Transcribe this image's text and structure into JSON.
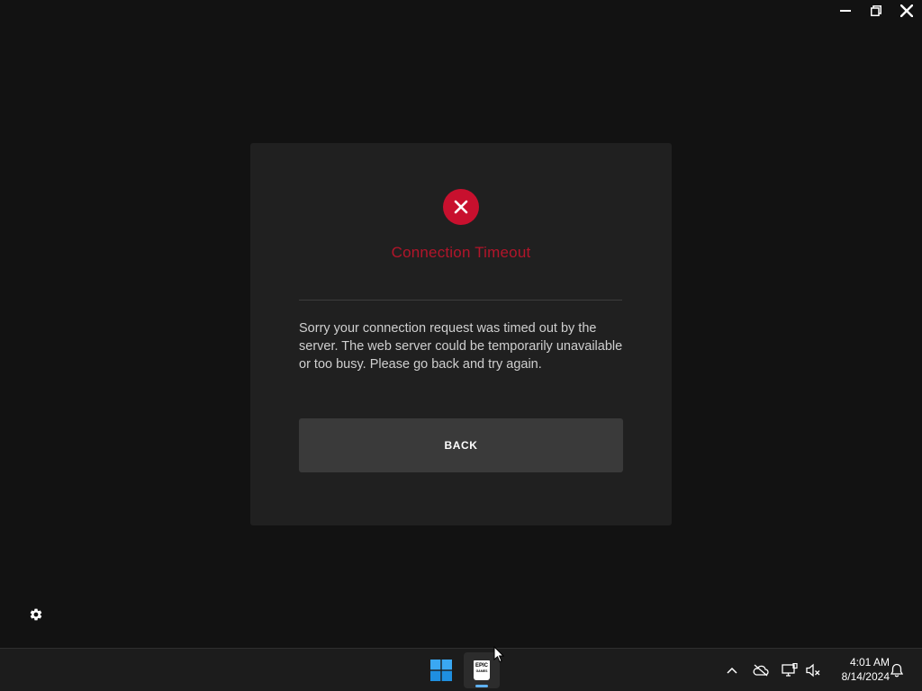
{
  "window": {
    "minimize_icon": "minimize-icon",
    "restore_icon": "restore-icon",
    "close_icon": "close-icon"
  },
  "dialog": {
    "icon": "error-circle-icon",
    "title": "Connection Timeout",
    "message": "Sorry your connection request was timed out by the server. The web server could be temporarily unavailable or too busy. Please go back and try again.",
    "back_label": "BACK"
  },
  "settings": {
    "icon": "gear-icon"
  },
  "taskbar": {
    "start_icon": "windows-start-icon",
    "pinned_app": {
      "name_line1": "EPIC",
      "name_line2": "GAMES",
      "active": true
    },
    "tray_icons": [
      "chevron-up-icon",
      "onedrive-offline-icon",
      "network-icon",
      "volume-muted-icon"
    ],
    "clock": {
      "time": "4:01 AM",
      "date": "8/14/2024"
    },
    "notification_icon": "bell-icon"
  },
  "colors": {
    "background": "#121212",
    "dialog_background": "#202020",
    "error_red": "#c8102e",
    "title_red": "#b3152a",
    "button_background": "#3a3a3a",
    "taskbar_background": "#1c1c1c",
    "accent_blue": "#5fb2f2"
  }
}
